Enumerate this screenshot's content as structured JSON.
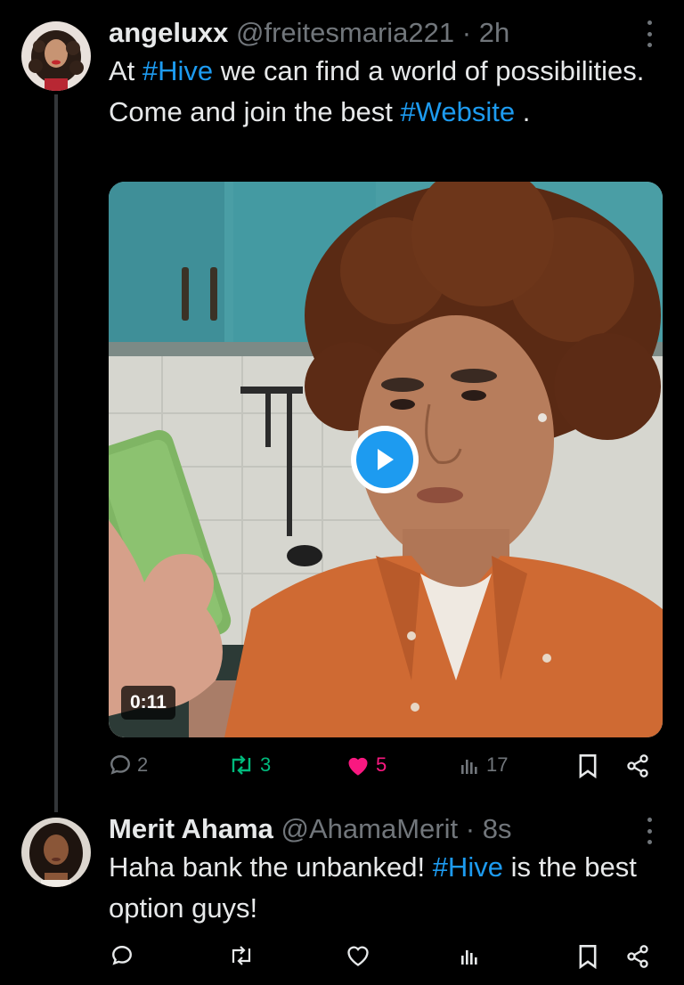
{
  "tweets": [
    {
      "name": "angeluxx",
      "handle": "@freitesmaria221",
      "separator": "·",
      "time": "2h",
      "text_parts": [
        "At ",
        "#Hive",
        " we can find a world of possibilities. Come and join the best ",
        "#Website",
        " ."
      ],
      "media": {
        "type": "video",
        "duration": "0:11"
      },
      "stats": {
        "replies": "2",
        "reposts": "3",
        "likes": "5",
        "views": "17"
      }
    },
    {
      "name": "Merit Ahama",
      "handle": "@AhamaMerit",
      "separator": "·",
      "time": "8s",
      "text_parts": [
        "Haha bank the unbanked! ",
        "#Hive",
        " is the best option guys!"
      ]
    }
  ],
  "colors": {
    "background": "#000000",
    "accent": "#1d9bf0",
    "repost_active": "#00ba7c",
    "like_active": "#f91880",
    "muted": "#71767b",
    "thread_line": "#333639"
  },
  "icons": {
    "reply": "reply-icon",
    "repost": "repost-icon",
    "like": "heart-icon",
    "views": "bar-chart-icon",
    "bookmark": "bookmark-icon",
    "share": "share-icon",
    "more": "more-dots-icon",
    "play": "play-icon"
  }
}
